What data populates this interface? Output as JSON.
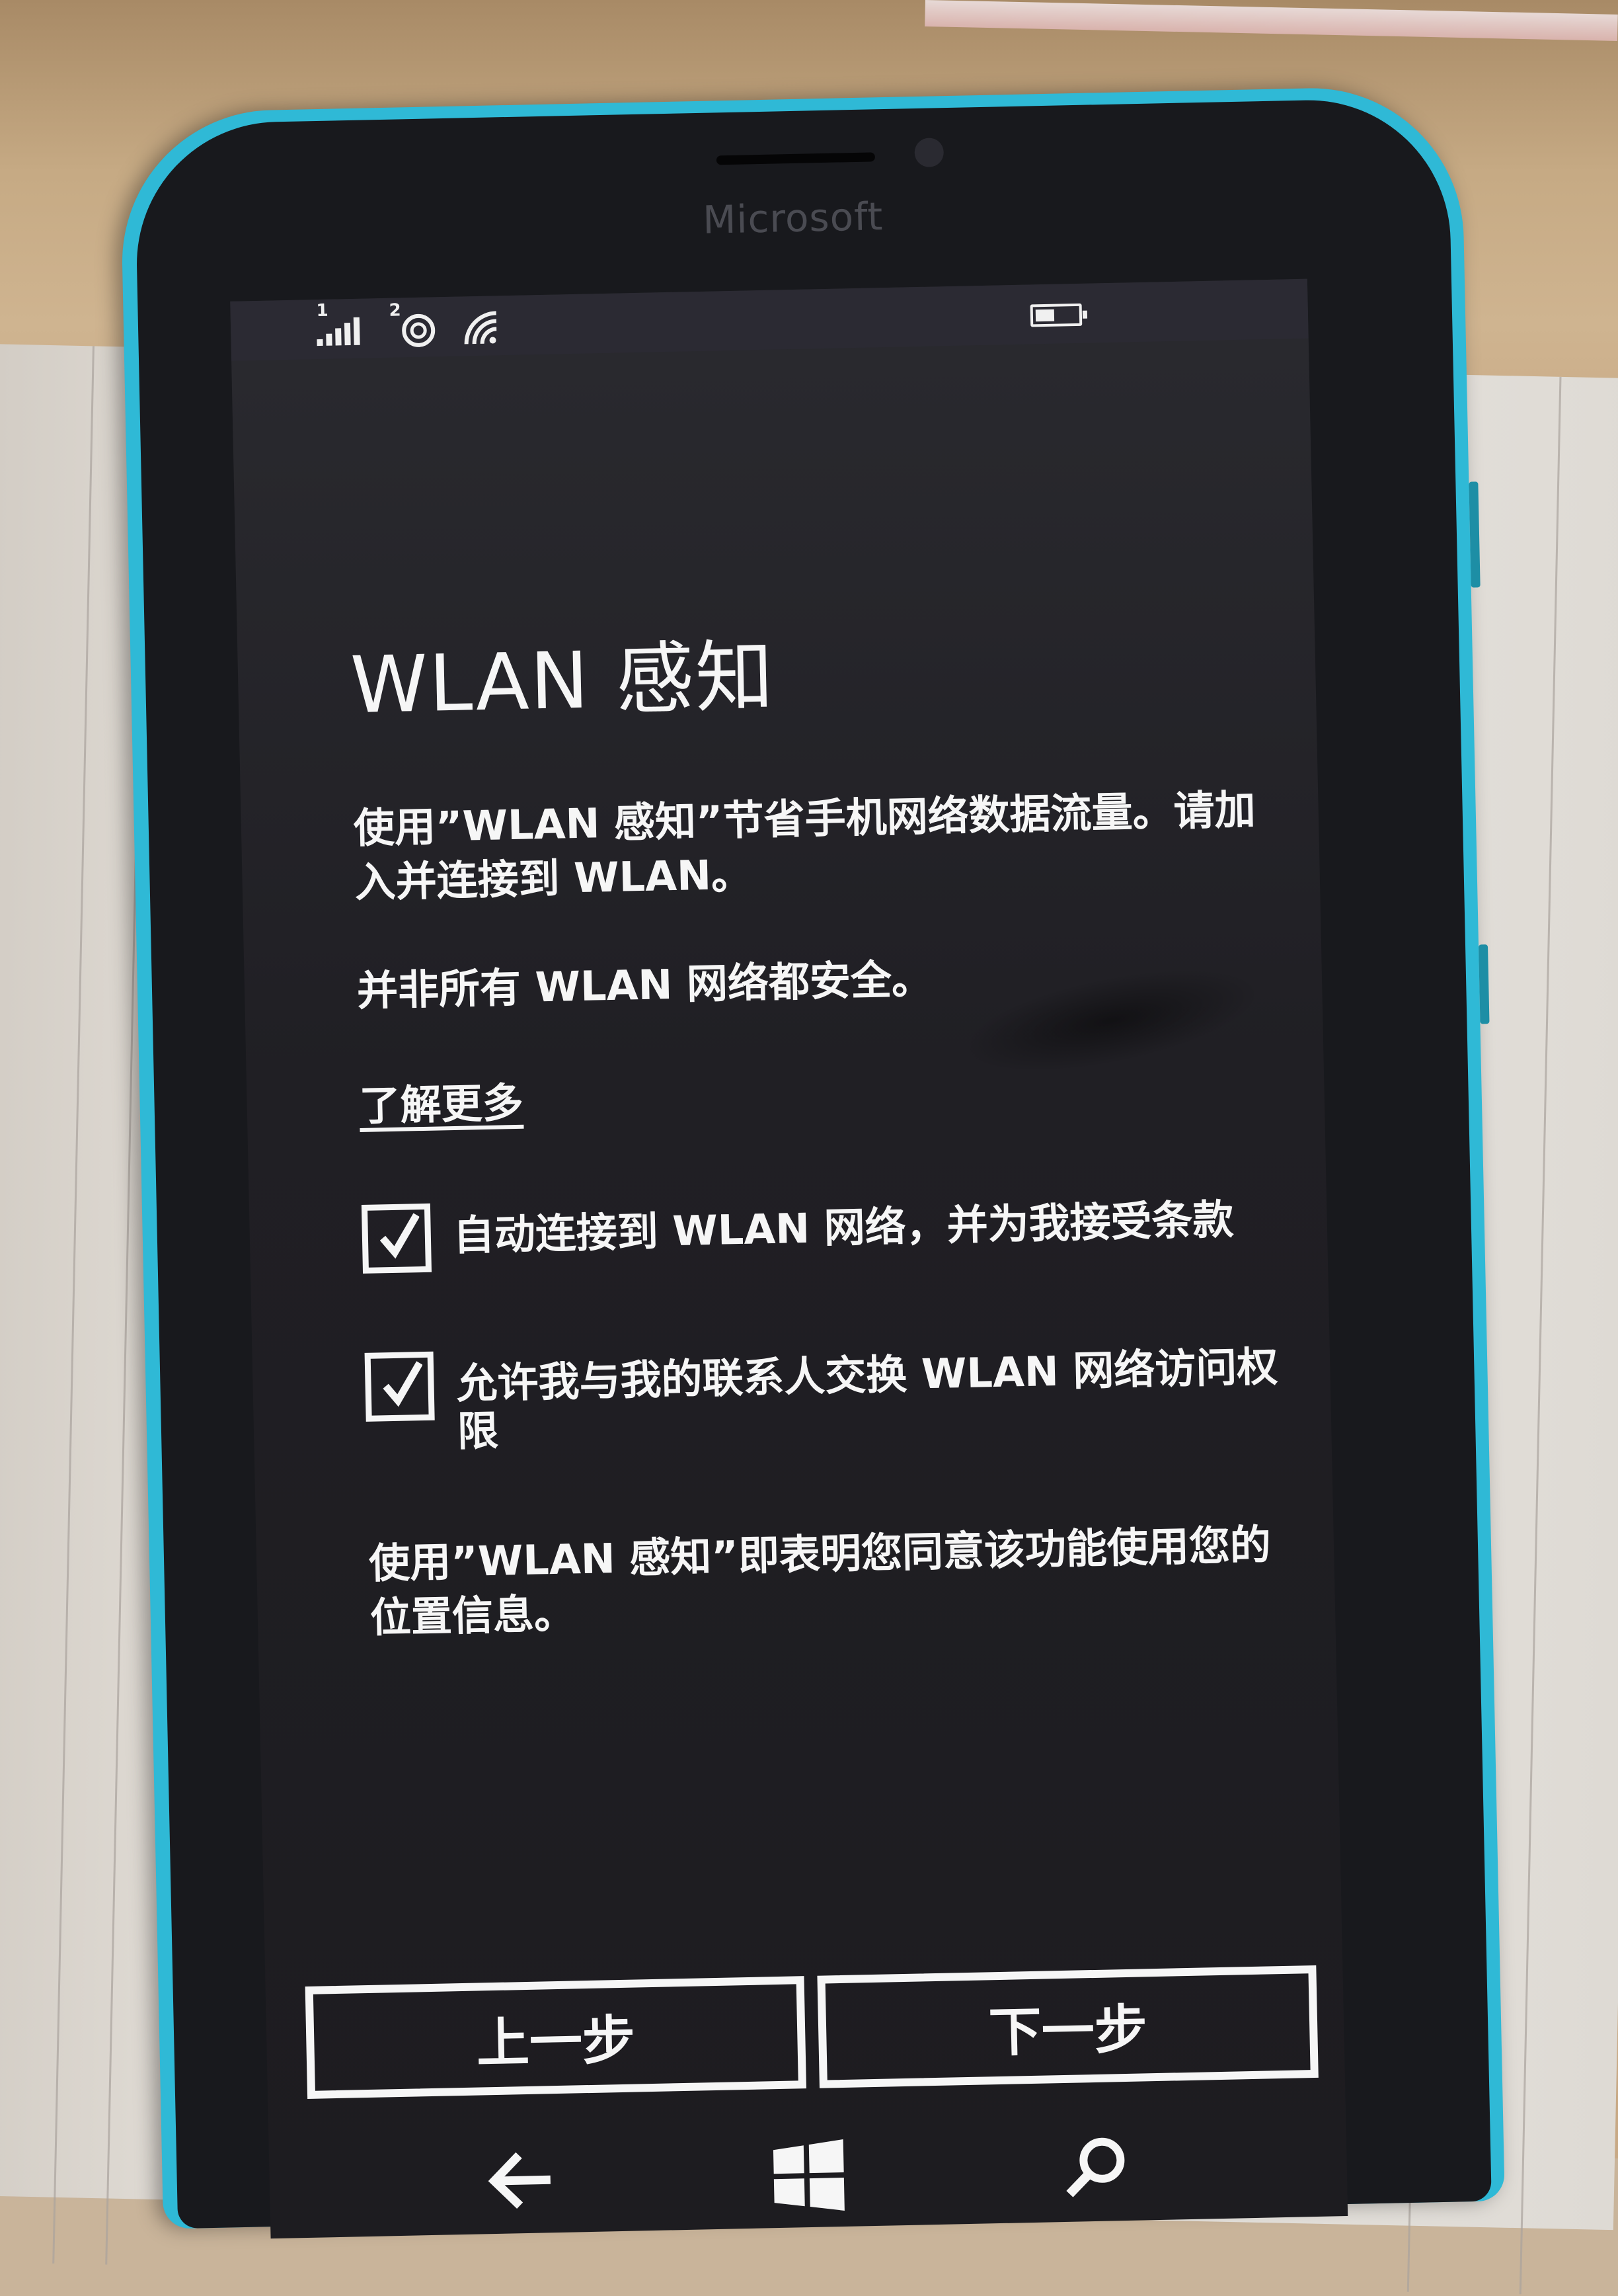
{
  "phone": {
    "brand": "Microsoft"
  },
  "status_bar": {
    "sim1_label": "1",
    "sim2_label": "2",
    "icons": [
      "signal-icon",
      "sim2-signal-icon",
      "wifi-icon",
      "battery-icon"
    ],
    "battery_level": 0.45
  },
  "page": {
    "title": "WLAN 感知",
    "description": "使用”WLAN 感知”节省手机网络数据流量。请加入并连接到 WLAN。",
    "warning": "并非所有 WLAN 网络都安全。",
    "learn_more": "了解更多",
    "options": [
      {
        "label": "自动连接到 WLAN 网络，并为我接受条款",
        "checked": true
      },
      {
        "label": "允许我与我的联系人交换 WLAN 网络访问权限",
        "checked": true
      }
    ],
    "location_notice": "使用”WLAN 感知”即表明您同意该功能使用您的位置信息。"
  },
  "buttons": {
    "back_label": "上一步",
    "next_label": "下一步"
  },
  "nav_bar": {
    "icons": [
      "back-arrow-icon",
      "windows-start-icon",
      "search-icon"
    ]
  },
  "colors": {
    "phone_body": "#2fb9d6",
    "screen_bg": "#1f1e23",
    "text": "#f6f6f6"
  }
}
